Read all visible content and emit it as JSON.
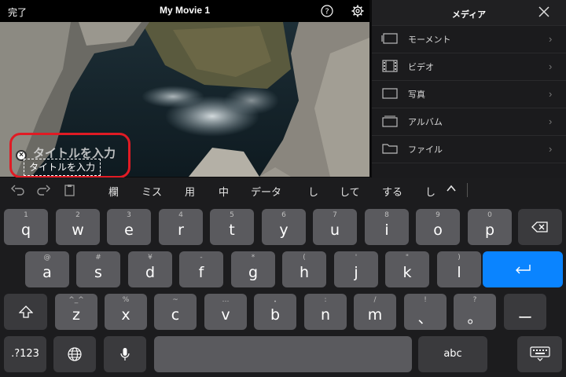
{
  "topbar": {
    "done_label": "完了",
    "title": "My Movie 1"
  },
  "preview": {
    "ghost_title": "タイトルを入力",
    "title_input_value": "タイトルを入力"
  },
  "media_panel": {
    "title": "メディア",
    "items": [
      {
        "label": "モーメント",
        "icon": "moments-icon"
      },
      {
        "label": "ビデオ",
        "icon": "film-icon"
      },
      {
        "label": "写真",
        "icon": "photo-icon"
      },
      {
        "label": "アルバム",
        "icon": "album-icon"
      },
      {
        "label": "ファイル",
        "icon": "folder-icon"
      }
    ]
  },
  "keyboard": {
    "suggestions": [
      "欄",
      "ミス",
      "用",
      "中",
      "データ",
      "し",
      "して",
      "する",
      "し"
    ],
    "row1": [
      {
        "main": "q",
        "sub": "1"
      },
      {
        "main": "w",
        "sub": "2"
      },
      {
        "main": "e",
        "sub": "3"
      },
      {
        "main": "r",
        "sub": "4"
      },
      {
        "main": "t",
        "sub": "5"
      },
      {
        "main": "y",
        "sub": "6"
      },
      {
        "main": "u",
        "sub": "7"
      },
      {
        "main": "i",
        "sub": "8"
      },
      {
        "main": "o",
        "sub": "9"
      },
      {
        "main": "p",
        "sub": "0"
      }
    ],
    "row2": [
      {
        "main": "a",
        "sub": "@"
      },
      {
        "main": "s",
        "sub": "#"
      },
      {
        "main": "d",
        "sub": "¥"
      },
      {
        "main": "f",
        "sub": "-"
      },
      {
        "main": "g",
        "sub": "*"
      },
      {
        "main": "h",
        "sub": "("
      },
      {
        "main": "j",
        "sub": "'"
      },
      {
        "main": "k",
        "sub": "\""
      },
      {
        "main": "l",
        "sub": ")"
      }
    ],
    "row3": [
      {
        "main": "z",
        "sub": "^_^"
      },
      {
        "main": "x",
        "sub": "%"
      },
      {
        "main": "c",
        "sub": "~"
      },
      {
        "main": "v",
        "sub": "…"
      },
      {
        "main": "b",
        "sub": "・"
      },
      {
        "main": "n",
        "sub": ":"
      },
      {
        "main": "m",
        "sub": "/"
      },
      {
        "main": "、",
        "sub": "!"
      },
      {
        "main": "。",
        "sub": "?"
      }
    ],
    "dash_key": "ー",
    "numbers_key": ".?123",
    "abc_key": "abc"
  }
}
